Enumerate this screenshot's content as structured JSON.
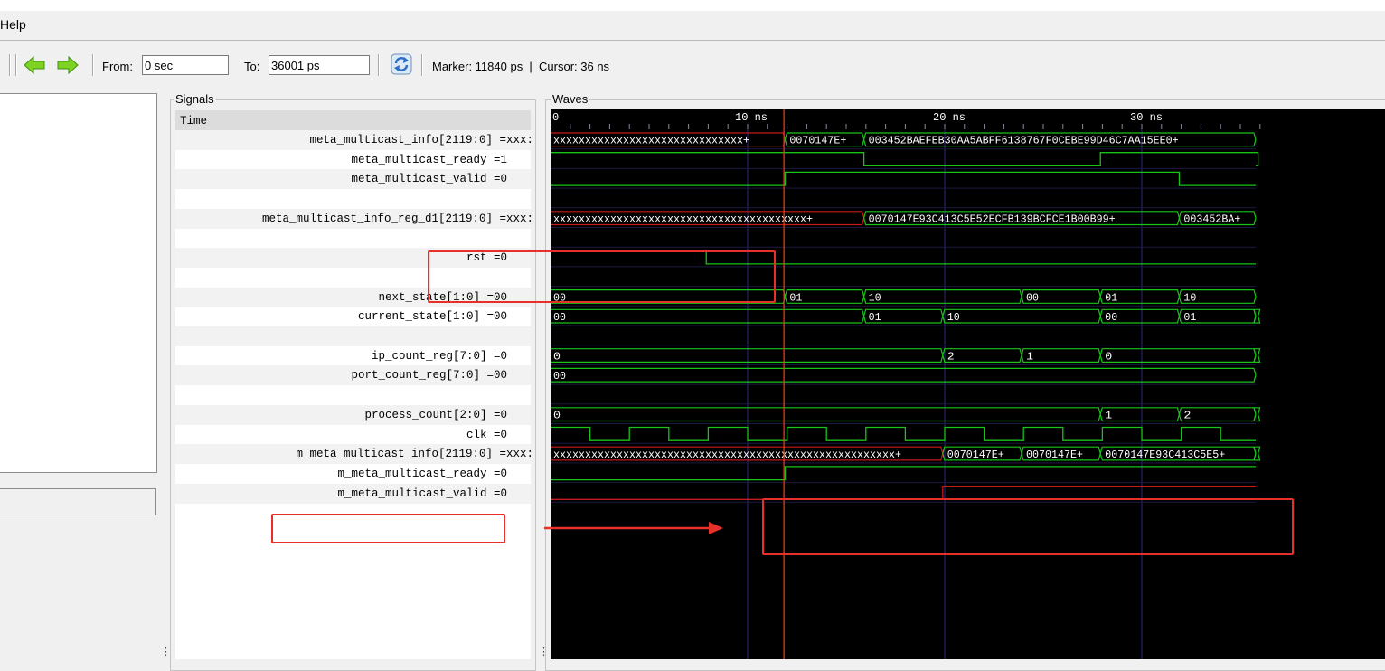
{
  "menu": {
    "help": "Help"
  },
  "toolbar": {
    "from_label": "From:",
    "from_value": "0 sec",
    "to_label": "To:",
    "to_value": "36001 ps",
    "marker_text": "Marker: 11840 ps  |  Cursor: 36 ns"
  },
  "signals_panel": {
    "title": "Signals",
    "time_label": "Time",
    "rows": [
      "meta_multicast_info[2119:0] =xxx:",
      "meta_multicast_ready =1",
      "meta_multicast_valid =0",
      "",
      "meta_multicast_info_reg_d1[2119:0] =xxx:",
      "",
      "rst =0",
      "",
      "next_state[1:0] =00",
      "current_state[1:0] =00",
      "",
      "ip_count_reg[7:0] =0",
      "port_count_reg[7:0] =00",
      "",
      "process_count[2:0] =0",
      "clk =0",
      "m_meta_multicast_info[2119:0] =xxx:",
      "m_meta_multicast_ready =0",
      "m_meta_multicast_valid =0"
    ]
  },
  "waves_panel": {
    "title": "Waves",
    "ruler": {
      "zero": "0",
      "t10": "10 ns",
      "t20": "20 ns",
      "t30": "30 ns"
    },
    "labels": {
      "info_x": "xxxxxxxxxxxxxxxxxxxxxxxxxxxxxx+",
      "info_1": "0070147E+",
      "info_2": "003452BAEFEB30AA5ABFF6138767F0CEBE99D46C7AA15EE0+",
      "reg_x": "xxxxxxxxxxxxxxxxxxxxxxxxxxxxxxxxxxxxxxxx+",
      "reg_1": "0070147E93C413C5E52ECFB139BCFCE1B00B99+",
      "reg_2": "003452BA+",
      "ns_0": "00",
      "ns_1": "01",
      "ns_2": "10",
      "ns_3": "00",
      "ns_4": "01",
      "ns_5": "10",
      "cs_0": "00",
      "cs_1": "01",
      "cs_2": "10",
      "cs_3": "00",
      "cs_4": "01",
      "ip_0": "0",
      "ip_1": "2",
      "ip_2": "1",
      "ip_3": "0",
      "port_0": "00",
      "pc_0": "0",
      "pc_1": "1",
      "pc_2": "2",
      "m_x": "xxxxxxxxxxxxxxxxxxxxxxxxxxxxxxxxxxxxxxxxxxxxxxxxxxxxxx+",
      "m_1": "0070147E+",
      "m_2": "0070147E+",
      "m_3": "0070147E93C413C5E5+"
    }
  },
  "colors": {
    "wave": "#19c319",
    "undefined": "#c41b1b",
    "grid": "#2a2a80",
    "cursor": "#ff3a1a",
    "annotation": "#e8302a"
  }
}
